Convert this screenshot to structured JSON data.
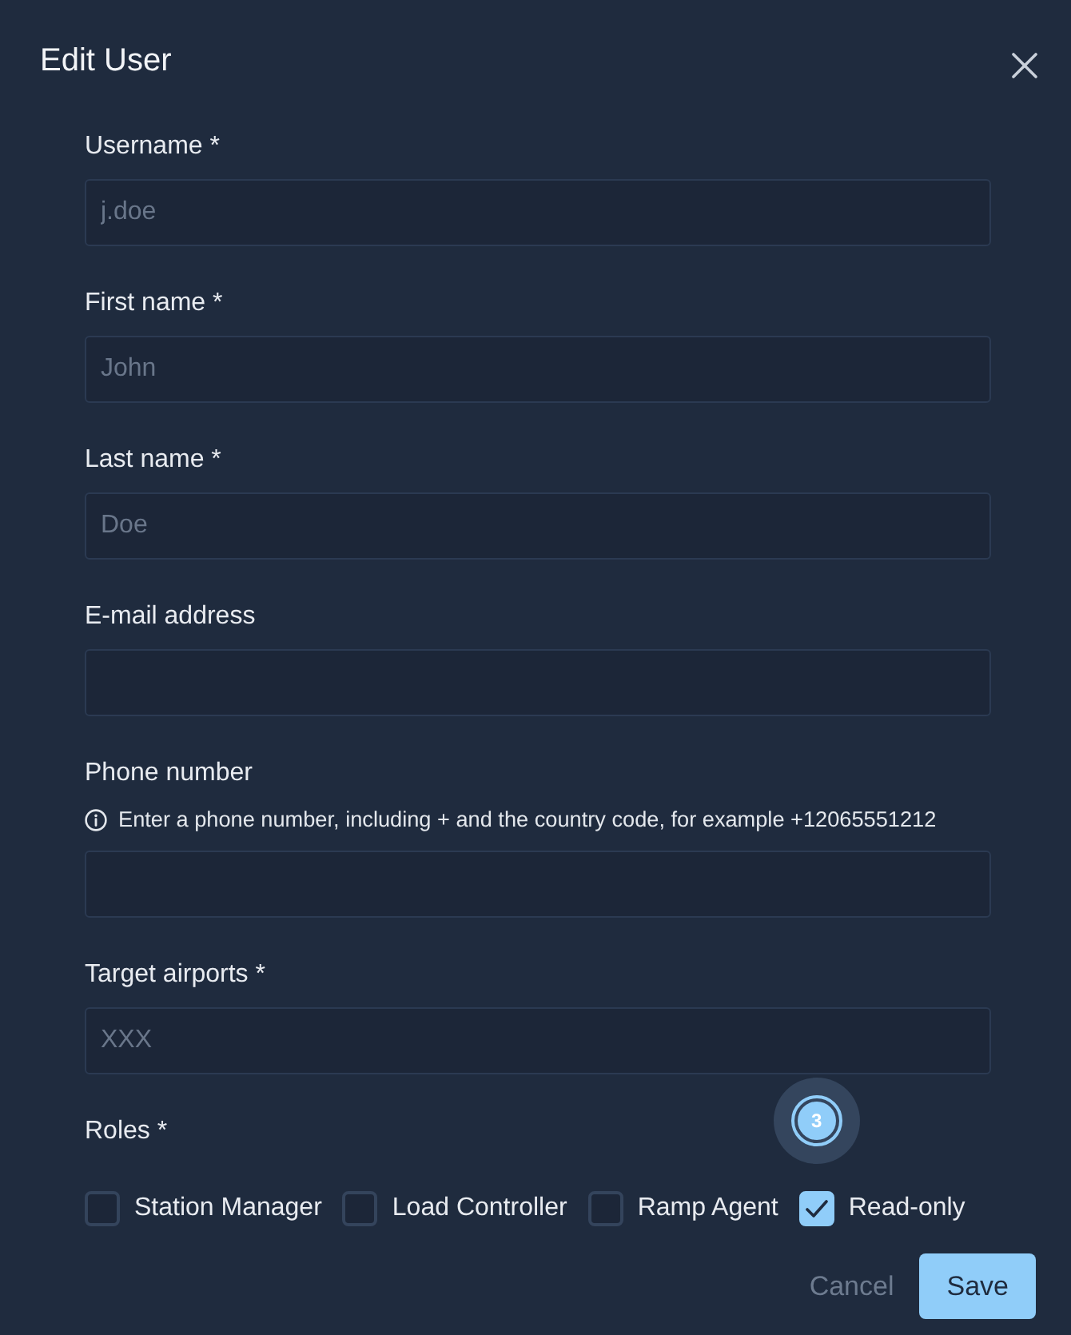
{
  "dialog": {
    "title": "Edit User"
  },
  "fields": [
    {
      "label": "Username *",
      "placeholder": "j.doe"
    },
    {
      "label": "First name *",
      "placeholder": "John"
    },
    {
      "label": "Last name *",
      "placeholder": "Doe"
    },
    {
      "label": "E-mail address"
    },
    {
      "label": "Phone number",
      "hint": "Enter a phone number, including + and the country code, for example +12065551212"
    },
    {
      "label": "Target airports *",
      "placeholder": "XXX"
    }
  ],
  "roles": {
    "label": "Roles *",
    "options": [
      {
        "label": "Station Manager",
        "checked": false
      },
      {
        "label": "Load Controller",
        "checked": false
      },
      {
        "label": "Ramp Agent",
        "checked": false
      },
      {
        "label": "Read-only",
        "checked": true,
        "marker": "3"
      }
    ]
  },
  "buttons": [
    {
      "label": "Cancel",
      "kind": "secondary"
    },
    {
      "label": "Save",
      "kind": "primary"
    }
  ]
}
